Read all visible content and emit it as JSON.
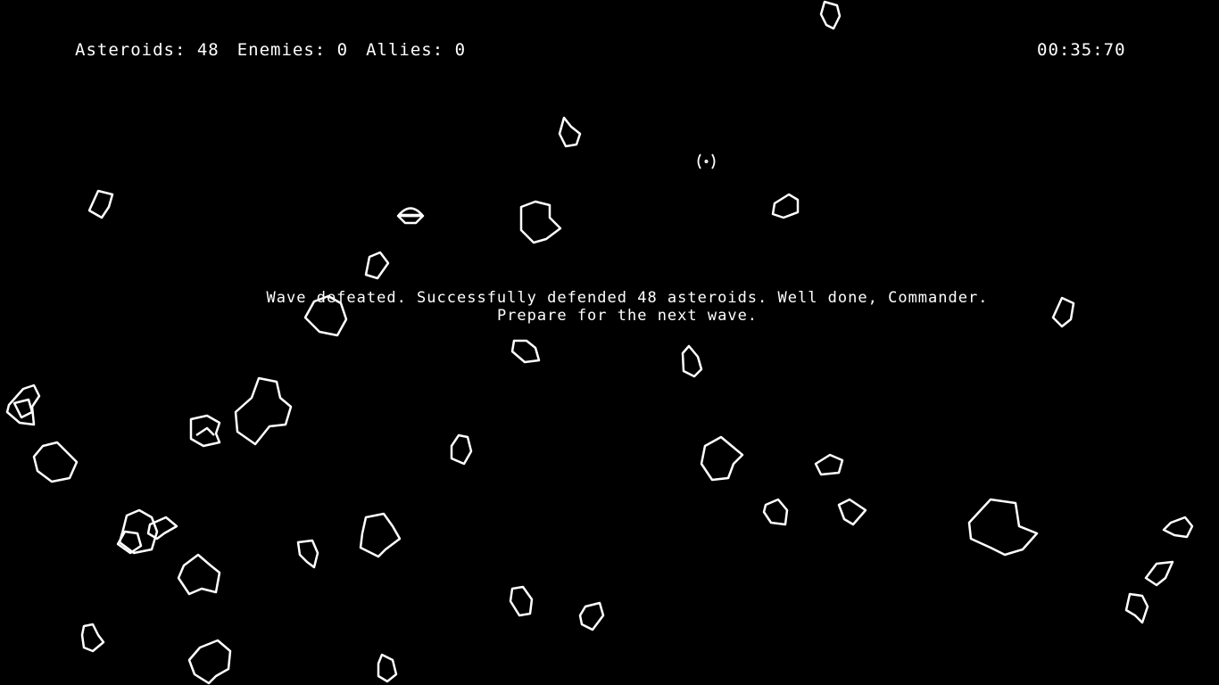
{
  "hud": {
    "asteroids_label": "Asteroids: 48",
    "enemies_label": "Enemies: 0",
    "allies_label": "Allies: 0",
    "timer": "00:35:70"
  },
  "message": {
    "line1": "Wave defeated. Successfully defended 48 asteroids. Well done, Commander.",
    "line2": "Prepare for the next wave."
  },
  "colors": {
    "background": "#000000",
    "foreground": "#ffffff"
  },
  "icons": {
    "player_ship": "saucer-ship-icon",
    "crosshair": "crosshair-icon"
  }
}
